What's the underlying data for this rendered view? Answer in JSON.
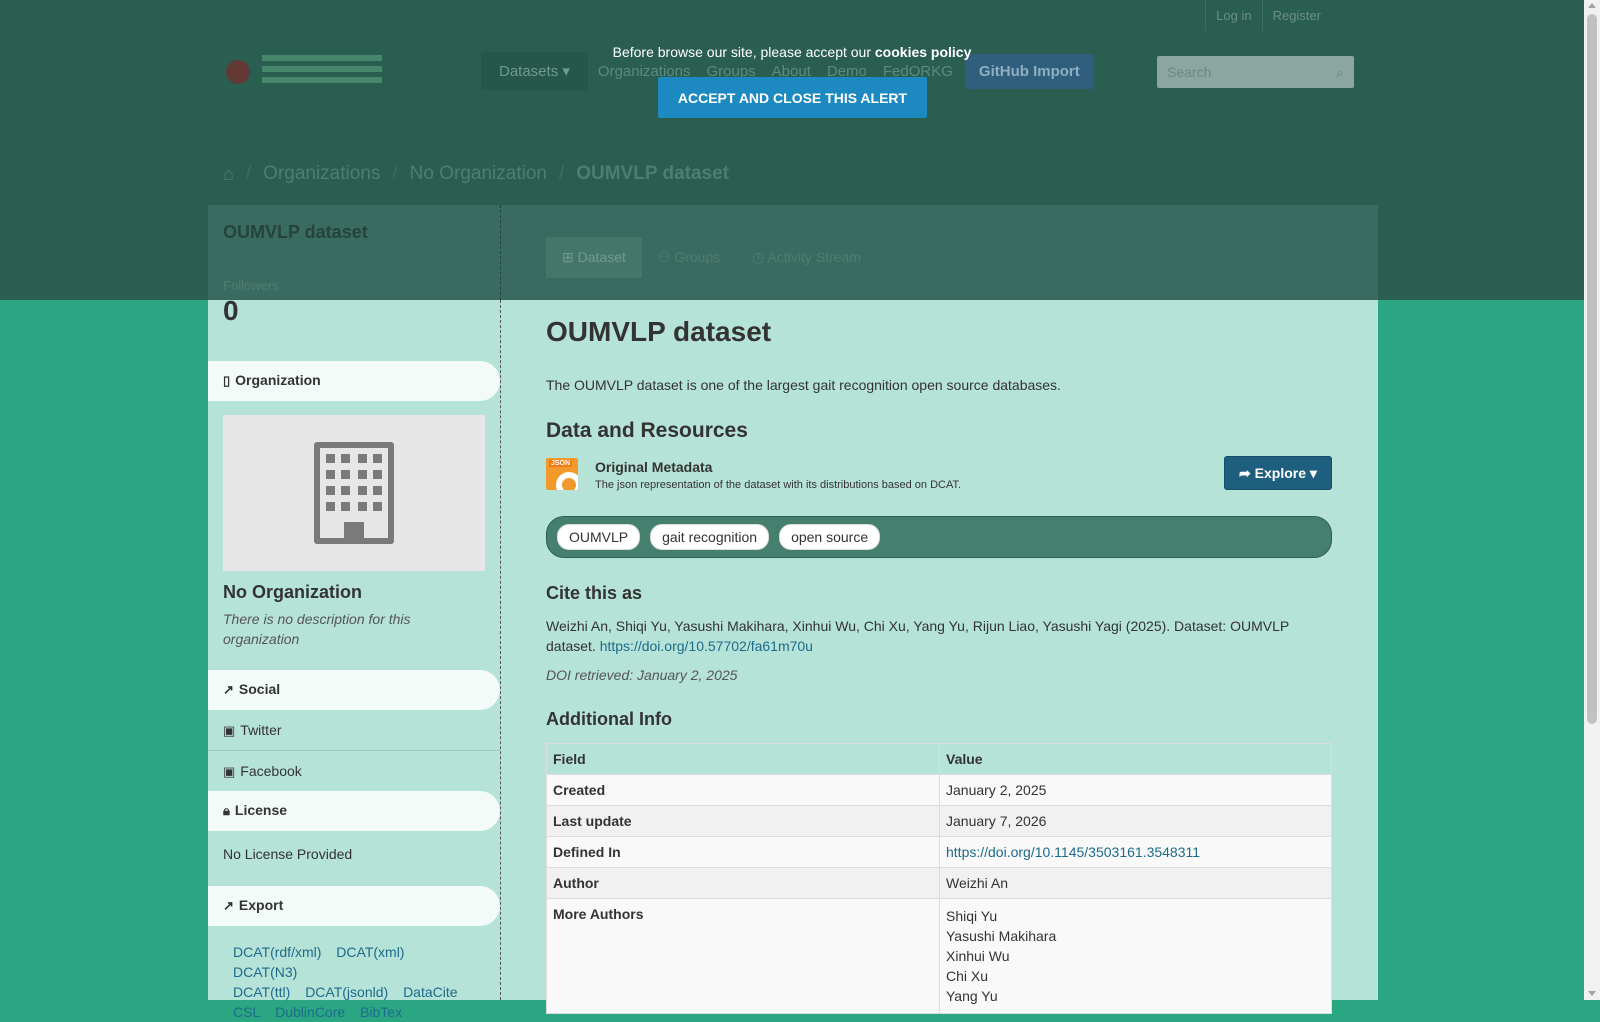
{
  "topbar": {
    "login": "Log in",
    "register": "Register"
  },
  "nav": {
    "datasets": "Datasets",
    "organizations": "Organizations",
    "groups": "Groups",
    "about": "About",
    "demo": "Demo",
    "fedorkg": "FedORKG",
    "github_import": "GitHub Import"
  },
  "search": {
    "placeholder": "Search"
  },
  "cookie": {
    "message": "Before browse our site, please accept our ",
    "policy": "cookies policy",
    "accept": "Accept and close this alert"
  },
  "breadcrumb": {
    "organizations": "Organizations",
    "org": "No Organization",
    "current": "OUMVLP dataset"
  },
  "sidebar": {
    "title": "OUMVLP dataset",
    "followers_label": "Followers",
    "followers_count": "0",
    "organization_heading": "Organization",
    "org_name": "No Organization",
    "org_desc": "There is no description for this organization",
    "social_heading": "Social",
    "twitter": "Twitter",
    "facebook": "Facebook",
    "license_heading": "License",
    "license_text": "No License Provided",
    "export_heading": "Export",
    "export_links": [
      "DCAT(rdf/xml)",
      "DCAT(xml)",
      "DCAT(N3)",
      "DCAT(ttl)",
      "DCAT(jsonld)",
      "DataCite",
      "CSL",
      "DublinCore",
      "BibTex"
    ]
  },
  "tabs": {
    "dataset": "Dataset",
    "groups": "Groups",
    "activity": "Activity Stream"
  },
  "main": {
    "title": "OUMVLP dataset",
    "description": "The OUMVLP dataset is one of the largest gait recognition open source databases.",
    "resources_heading": "Data and Resources",
    "resource_icon_label": "JSON",
    "resource_title": "Original Metadata",
    "resource_desc": "The json representation of the dataset with its distributions based on DCAT.",
    "explore": "Explore",
    "tags": [
      "OUMVLP",
      "gait recognition",
      "open source"
    ],
    "cite_heading": "Cite this as",
    "cite_text": "Weizhi An, Shiqi Yu, Yasushi Makihara, Xinhui Wu, Chi Xu, Yang Yu, Rijun Liao, Yasushi Yagi (2025). Dataset: OUMVLP dataset. ",
    "cite_doi": "https://doi.org/10.57702/fa61m70u",
    "doi_retrieved": "DOI retrieved: January 2, 2025",
    "additional_heading": "Additional Info",
    "table_headers": {
      "field": "Field",
      "value": "Value"
    },
    "rows": {
      "created": {
        "field": "Created",
        "value": "January 2, 2025"
      },
      "last_update": {
        "field": "Last update",
        "value": "January 7, 2026"
      },
      "defined_in": {
        "field": "Defined In",
        "value": "https://doi.org/10.1145/3503161.3548311"
      },
      "author": {
        "field": "Author",
        "value": "Weizhi An"
      },
      "more_authors": {
        "field": "More Authors",
        "values": [
          "Shiqi Yu",
          "Yasushi Makihara",
          "Xinhui Wu",
          "Chi Xu",
          "Yang Yu"
        ]
      }
    }
  },
  "colors": {
    "page_bg": "#2aa683",
    "content_bg": "#b6e3d7",
    "overlay": "#2a5e51",
    "accept_button": "#1c8ac0",
    "explore_button": "#1e5f80",
    "link": "#1d6a8a"
  }
}
